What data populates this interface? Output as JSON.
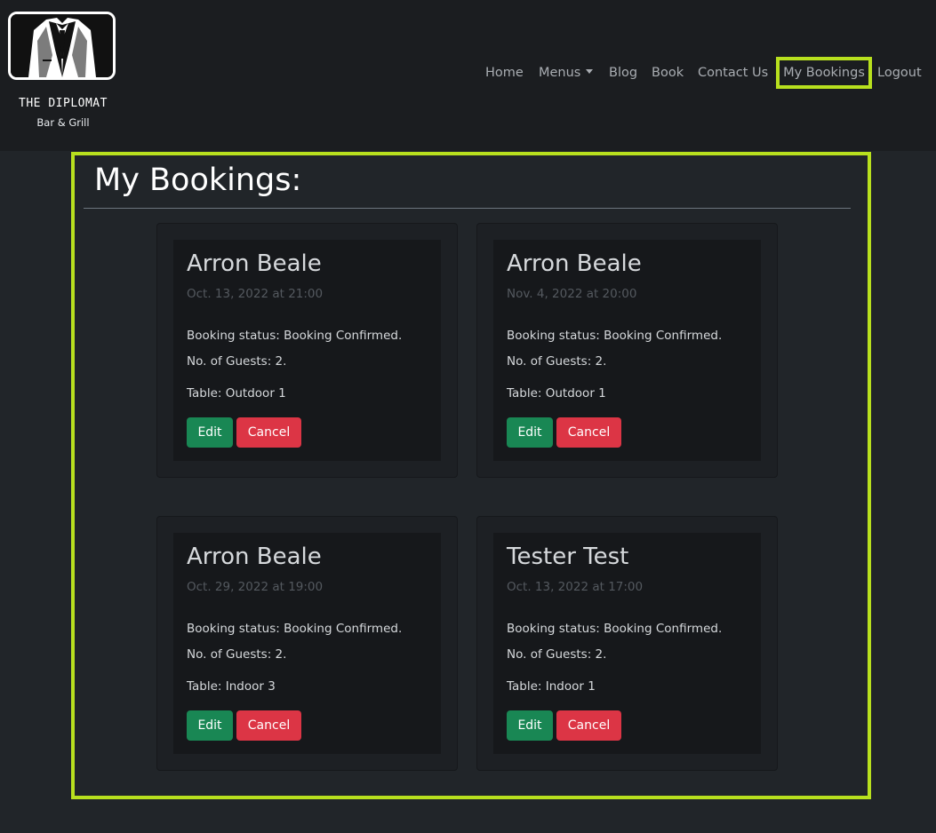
{
  "brand": {
    "title": "THE DIPLOMAT",
    "subtitle": "Bar & Grill"
  },
  "nav": {
    "items": [
      {
        "label": "Home"
      },
      {
        "label": "Menus"
      },
      {
        "label": "Blog"
      },
      {
        "label": "Book"
      },
      {
        "label": "Contact Us"
      },
      {
        "label": "My Bookings"
      },
      {
        "label": "Logout"
      }
    ],
    "active": "My Bookings",
    "highlight_color": "#b8e01e"
  },
  "page": {
    "title": "My Bookings:"
  },
  "bookings": [
    {
      "name": "Arron Beale",
      "date": "Oct. 13, 2022 at 21:00",
      "status": "Booking status: Booking Confirmed.",
      "guests": "No. of Guests: 2.",
      "table": "Table: Outdoor 1",
      "edit_label": "Edit",
      "cancel_label": "Cancel"
    },
    {
      "name": "Arron Beale",
      "date": "Nov. 4, 2022 at 20:00",
      "status": "Booking status: Booking Confirmed.",
      "guests": "No. of Guests: 2.",
      "table": "Table: Outdoor 1",
      "edit_label": "Edit",
      "cancel_label": "Cancel"
    },
    {
      "name": "Arron Beale",
      "date": "Oct. 29, 2022 at 19:00",
      "status": "Booking status: Booking Confirmed.",
      "guests": "No. of Guests: 2.",
      "table": "Table: Indoor 3",
      "edit_label": "Edit",
      "cancel_label": "Cancel"
    },
    {
      "name": "Tester Test",
      "date": "Oct. 13, 2022 at 17:00",
      "status": "Booking status: Booking Confirmed.",
      "guests": "No. of Guests: 2.",
      "table": "Table: Indoor 1",
      "edit_label": "Edit",
      "cancel_label": "Cancel"
    }
  ],
  "colors": {
    "background": "#212529",
    "navbar": "#1b1d20",
    "edit_button": "#198754",
    "cancel_button": "#dc3545"
  }
}
